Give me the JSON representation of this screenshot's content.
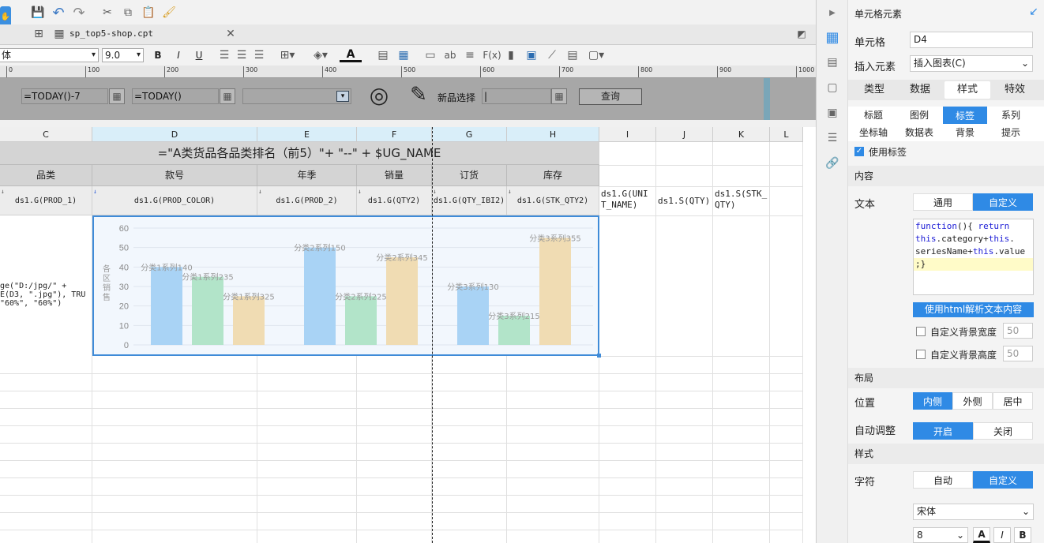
{
  "toolbar": {
    "font_name": "体",
    "font_size": "9.0"
  },
  "tab": {
    "file_name": "sp_top5-shop.cpt"
  },
  "ruler": {
    "marks": [
      "0",
      "100",
      "200",
      "300",
      "400",
      "500",
      "600",
      "700",
      "800",
      "900",
      "1000"
    ]
  },
  "params": {
    "start_date": "=TODAY()-7",
    "end_date": "=TODAY()",
    "new_label": "新品选择",
    "query_button": "查询"
  },
  "columns": [
    "C",
    "D",
    "E",
    "F",
    "G",
    "H",
    "I",
    "J",
    "K",
    "L"
  ],
  "sheet": {
    "title_formula": "=\"A类货品各品类排名（前5）\"+ \"--\" + $UG_NAME",
    "headers": [
      "品类",
      "款号",
      "年季",
      "销量",
      "订货",
      "库存"
    ],
    "row3": [
      "ds1.G(PROD_1)",
      "ds1.G(PROD_COLOR)",
      "ds1.G(PROD_2)",
      "ds1.G(QTY2)",
      "ds1.G(QTY_IBI2)",
      "ds1.G(STK_QTY2)",
      "ds1.G(UNIT_NAME)",
      "ds1.S(QTY)",
      "ds1.S(STK_QTY)"
    ],
    "row3_I_lines": [
      "ds1.G(UNI",
      "T_NAME)"
    ],
    "row3_K_lines": [
      "ds1.S(STK_",
      "QTY)"
    ],
    "img_formula_lines": [
      "ge(\"D:/jpg/\" +",
      "E(D3, \".jpg\"), TRU",
      "\"60%\", \"60%\")"
    ]
  },
  "chart_data": {
    "type": "bar",
    "ylabel": "各区销售",
    "ylim": [
      0,
      60
    ],
    "yticks": [
      "0",
      "10",
      "20",
      "30",
      "40",
      "50",
      "60"
    ],
    "groups": [
      {
        "bars": [
          {
            "value": 40,
            "color": "#a9d3f5",
            "label": "分类1系列140"
          },
          {
            "value": 35,
            "color": "#b2e4c9",
            "label": "分类1系列235"
          },
          {
            "value": 25,
            "color": "#f0dcb3",
            "label": "分类1系列325"
          }
        ]
      },
      {
        "bars": [
          {
            "value": 50,
            "color": "#a9d3f5",
            "label": "分类2系列150"
          },
          {
            "value": 25,
            "color": "#b2e4c9",
            "label": "分类2系列225"
          },
          {
            "value": 45,
            "color": "#f0dcb3",
            "label": "分类2系列345"
          }
        ]
      },
      {
        "bars": [
          {
            "value": 30,
            "color": "#a9d3f5",
            "label": "分类3系列130"
          },
          {
            "value": 15,
            "color": "#b2e4c9",
            "label": "分类3系列215"
          },
          {
            "value": 55,
            "color": "#f0dcb3",
            "label": "分类3系列355"
          }
        ]
      }
    ]
  },
  "panel": {
    "title": "单元格元素",
    "cell_label": "单元格",
    "cell_value": "D4",
    "insert_label": "插入元素",
    "insert_value": "插入图表(C)",
    "tabs": [
      "类型",
      "数据",
      "样式",
      "特效"
    ],
    "subtabs": [
      "标题",
      "图例",
      "标签",
      "系列",
      "坐标轴",
      "数据表",
      "背景",
      "提示"
    ],
    "use_label": "使用标签",
    "content_section": "内容",
    "text_label": "文本",
    "text_modes": [
      "通用",
      "自定义"
    ],
    "code": {
      "kw1": "function",
      "p1": "(){ ",
      "kw2": "return",
      "kw3": "this",
      "s1": ".category+",
      "kw4": "this",
      "s2": ".",
      "s3": "seriesName+",
      "kw5": "this",
      "s4": ".value",
      "end": ";}"
    },
    "html_button": "使用html解析文本内容",
    "custom_bg_width": "自定义背景宽度",
    "custom_bg_height": "自定义背景高度",
    "width_val": "50",
    "height_val": "50",
    "layout_section": "布局",
    "position_label": "位置",
    "position_modes": [
      "内侧",
      "外侧",
      "居中"
    ],
    "auto_label": "自动调整",
    "auto_modes": [
      "开启",
      "关闭"
    ],
    "style_section": "样式",
    "char_label": "字符",
    "char_modes": [
      "自动",
      "自定义"
    ],
    "font_value": "宋体",
    "size_value": "8",
    "bold": "B",
    "italic": "I",
    "font_color": "A"
  }
}
